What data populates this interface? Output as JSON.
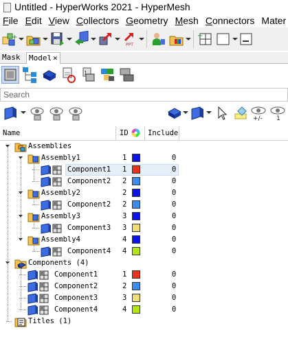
{
  "window": {
    "title": "Untitled - HyperWorks 2021 - HyperMesh"
  },
  "menu": [
    {
      "label": "File",
      "accel": "F",
      "rest": "ile"
    },
    {
      "label": "Edit",
      "accel": "E",
      "rest": "dit"
    },
    {
      "label": "View",
      "accel": "V",
      "rest": "iew"
    },
    {
      "label": "Collectors",
      "accel": "C",
      "rest": "ollectors"
    },
    {
      "label": "Geometry",
      "accel": "G",
      "rest": "eometry"
    },
    {
      "label": "Mesh",
      "accel": "M",
      "rest": "esh"
    },
    {
      "label": "Connectors",
      "accel": "C",
      "rest": "onnectors"
    },
    {
      "label": "Mater",
      "accel": "",
      "rest": "Mater"
    }
  ],
  "tabs": [
    {
      "label": "Mask",
      "active": false
    },
    {
      "label": "Model",
      "active": true,
      "close": "×"
    }
  ],
  "search": {
    "placeholder": "Search"
  },
  "columns": {
    "name": "Name",
    "id": "ID",
    "include": "Include"
  },
  "colors": {
    "blue": "#0a14e6",
    "red": "#e8321e",
    "lightblue": "#3c8cf0",
    "yellow": "#f0dc78",
    "lime": "#b4e614",
    "selection": "#e6eef8"
  },
  "tree": [
    {
      "label": "Assemblies",
      "type": "folder",
      "level": 0,
      "expanded": true,
      "id": "",
      "color": "",
      "include": ""
    },
    {
      "label": "Assembly1",
      "type": "assembly",
      "level": 1,
      "expanded": true,
      "id": "1",
      "color": "blue",
      "include": "0"
    },
    {
      "label": "Component1",
      "type": "component",
      "level": 2,
      "id": "1",
      "color": "red",
      "include": "0",
      "selected": true
    },
    {
      "label": "Component2",
      "type": "component",
      "level": 2,
      "id": "2",
      "color": "lightblue",
      "include": "0"
    },
    {
      "label": "Assembly2",
      "type": "assembly",
      "level": 1,
      "expanded": true,
      "id": "2",
      "color": "blue",
      "include": "0"
    },
    {
      "label": "Component2",
      "type": "component",
      "level": 2,
      "id": "2",
      "color": "lightblue",
      "include": "0"
    },
    {
      "label": "Assembly3",
      "type": "assembly",
      "level": 1,
      "expanded": true,
      "id": "3",
      "color": "blue",
      "include": "0"
    },
    {
      "label": "Component3",
      "type": "component",
      "level": 2,
      "id": "3",
      "color": "yellow",
      "include": "0"
    },
    {
      "label": "Assembly4",
      "type": "assembly",
      "level": 1,
      "expanded": true,
      "id": "4",
      "color": "blue",
      "include": "0"
    },
    {
      "label": "Component4",
      "type": "component",
      "level": 2,
      "id": "4",
      "color": "lime",
      "include": "0"
    },
    {
      "label": "Components (4)",
      "type": "components-folder",
      "level": 0,
      "expanded": true,
      "id": "",
      "color": "",
      "include": ""
    },
    {
      "label": "Component1",
      "type": "component",
      "level": 1,
      "id": "1",
      "color": "red",
      "include": "0"
    },
    {
      "label": "Component2",
      "type": "component",
      "level": 1,
      "id": "2",
      "color": "lightblue",
      "include": "0"
    },
    {
      "label": "Component3",
      "type": "component",
      "level": 1,
      "id": "3",
      "color": "yellow",
      "include": "0"
    },
    {
      "label": "Component4",
      "type": "component",
      "level": 1,
      "id": "4",
      "color": "lime",
      "include": "0"
    },
    {
      "label": "Titles (1)",
      "type": "titles-folder",
      "level": 0,
      "expanded": false,
      "id": "",
      "color": "",
      "include": ""
    }
  ]
}
